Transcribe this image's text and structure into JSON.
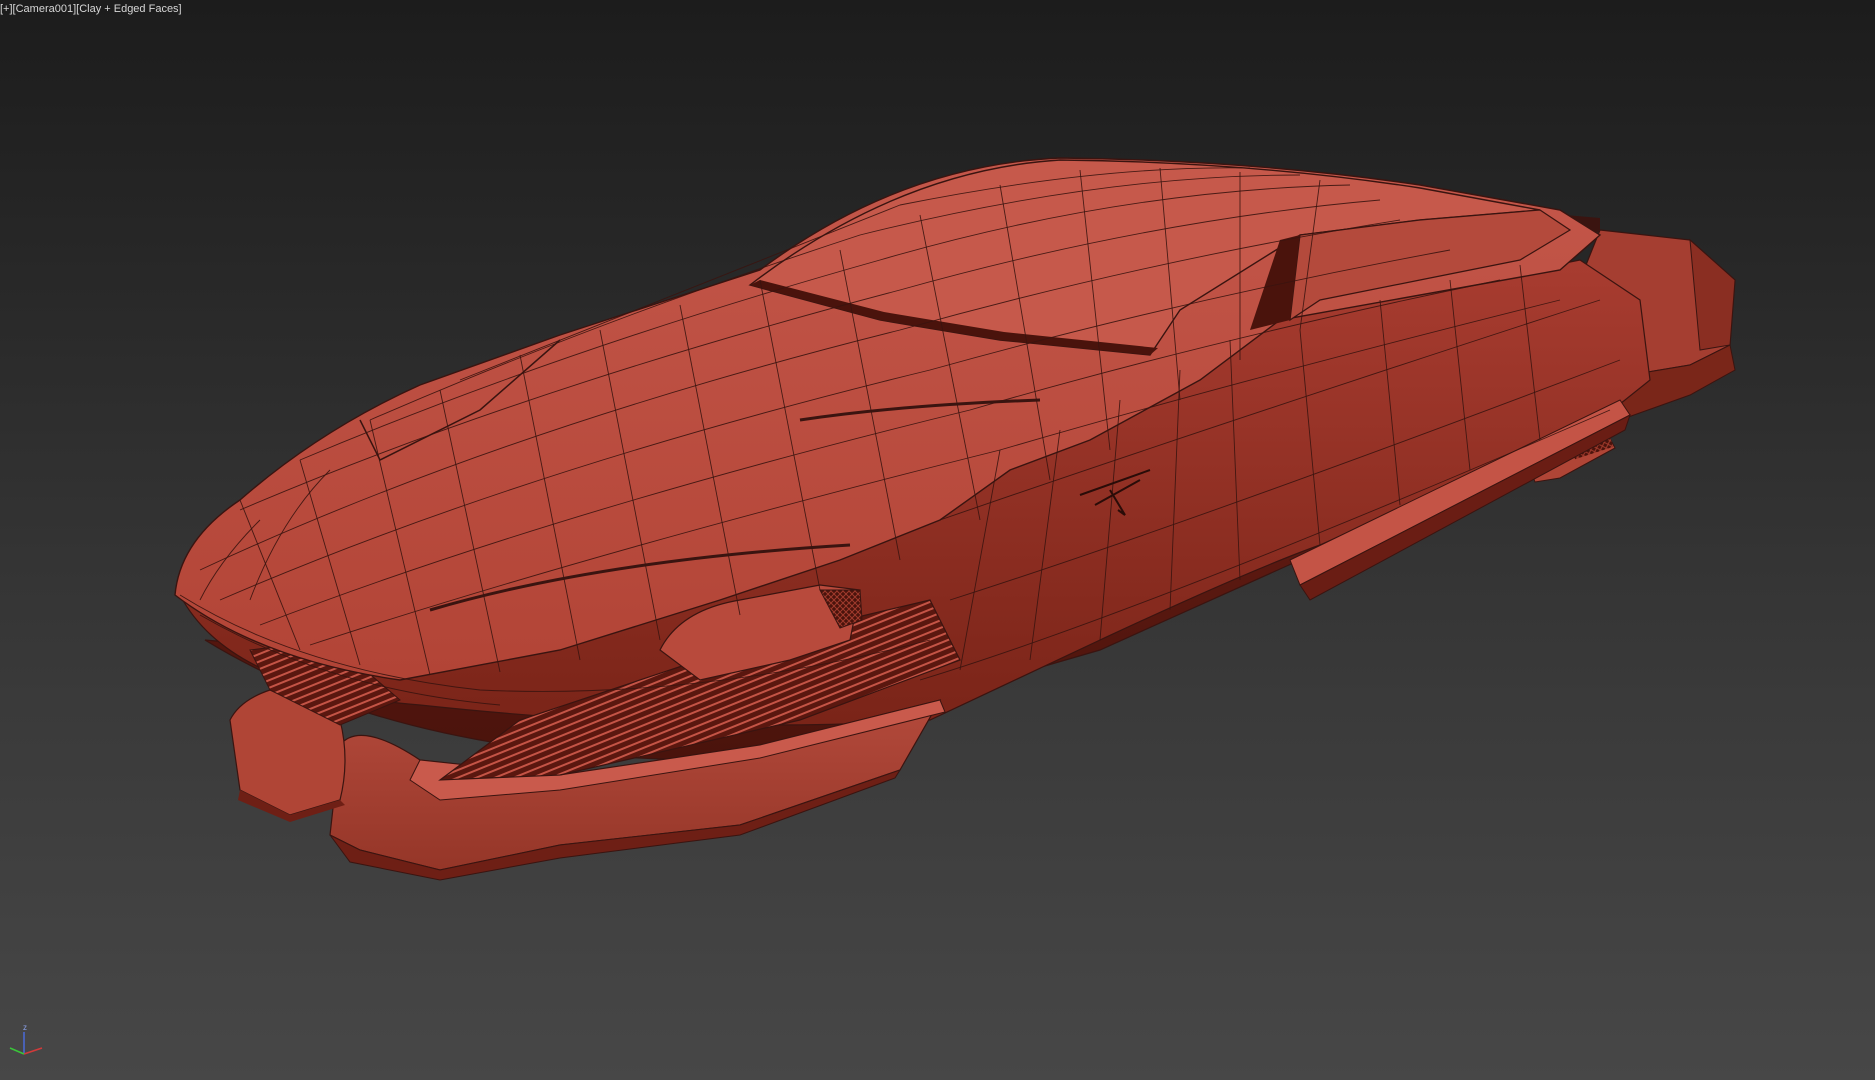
{
  "viewport": {
    "menu_label": "[+]",
    "camera_label": "[Camera001]",
    "shading_label": "[Clay + Edged Faces]"
  },
  "gizmo": {
    "z_label": "z",
    "x_color": "#d23a3a",
    "y_color": "#3ac43a",
    "z_color": "#4a6ad8"
  },
  "model": {
    "name": "hover-car",
    "clay_color": "#b94a3c",
    "wire_color": "#3a1410"
  }
}
